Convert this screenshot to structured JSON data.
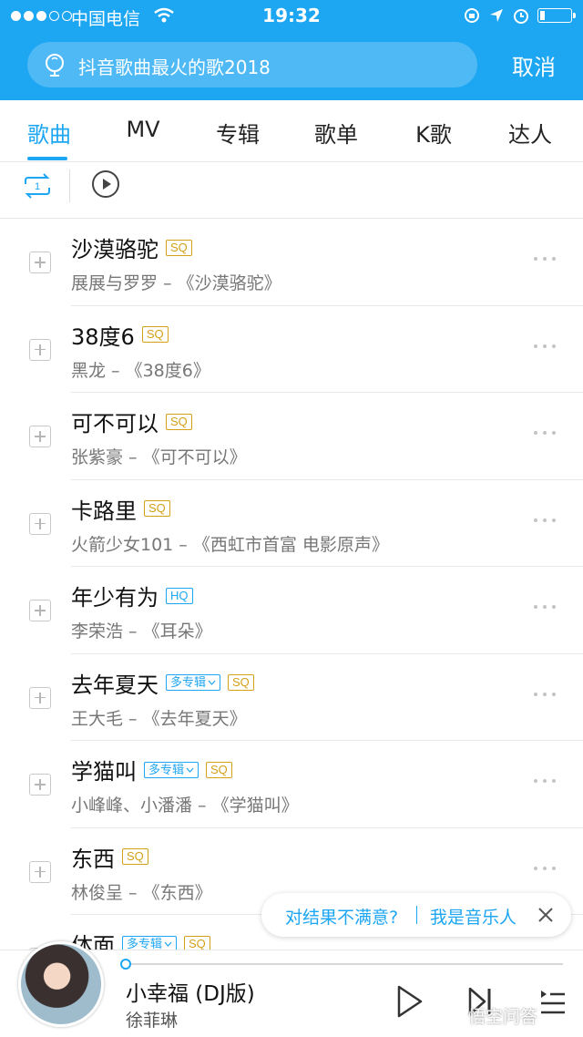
{
  "status_bar": {
    "carrier": "中国电信",
    "time": "19:32"
  },
  "search": {
    "query": "抖音歌曲最火的歌2018",
    "cancel_label": "取消"
  },
  "tabs": [
    {
      "label": "歌曲",
      "active": true
    },
    {
      "label": "MV"
    },
    {
      "label": "专辑"
    },
    {
      "label": "歌单"
    },
    {
      "label": "K歌"
    },
    {
      "label": "达人"
    }
  ],
  "toolbar": {
    "loop_badge": "1"
  },
  "songs": [
    {
      "title": "沙漠骆驼",
      "tags": [
        "SQ"
      ],
      "subtitle": "展展与罗罗 – 《沙漠骆驼》"
    },
    {
      "title": "38度6",
      "tags": [
        "SQ"
      ],
      "subtitle": "黑龙 – 《38度6》"
    },
    {
      "title": "可不可以",
      "tags": [
        "SQ"
      ],
      "subtitle": "张紫豪 – 《可不可以》"
    },
    {
      "title": "卡路里",
      "tags": [
        "SQ"
      ],
      "subtitle": "火箭少女101 – 《西虹市首富 电影原声》"
    },
    {
      "title": "年少有为",
      "tags": [
        "HQ"
      ],
      "subtitle": "李荣浩 – 《耳朵》"
    },
    {
      "title": "去年夏天",
      "tags": [
        "多专辑",
        "SQ"
      ],
      "subtitle": "王大毛 – 《去年夏天》"
    },
    {
      "title": "学猫叫",
      "tags": [
        "多专辑",
        "SQ"
      ],
      "subtitle": "小峰峰、小潘潘 – 《学猫叫》"
    },
    {
      "title": "东西",
      "tags": [
        "SQ"
      ],
      "subtitle": "林俊呈 – 《东西》"
    },
    {
      "title": "体面",
      "tags": [
        "多专辑",
        "SQ"
      ],
      "subtitle": ""
    }
  ],
  "feedback": {
    "question": "对结果不满意?",
    "link": "我是音乐人"
  },
  "player": {
    "title": "小幸福 (DJ版)",
    "artist": "徐菲琳",
    "progress": 0.0,
    "watermark": "悟空问答"
  },
  "colors": {
    "accent": "#1da6f2",
    "sq_gold": "#d4a017"
  }
}
